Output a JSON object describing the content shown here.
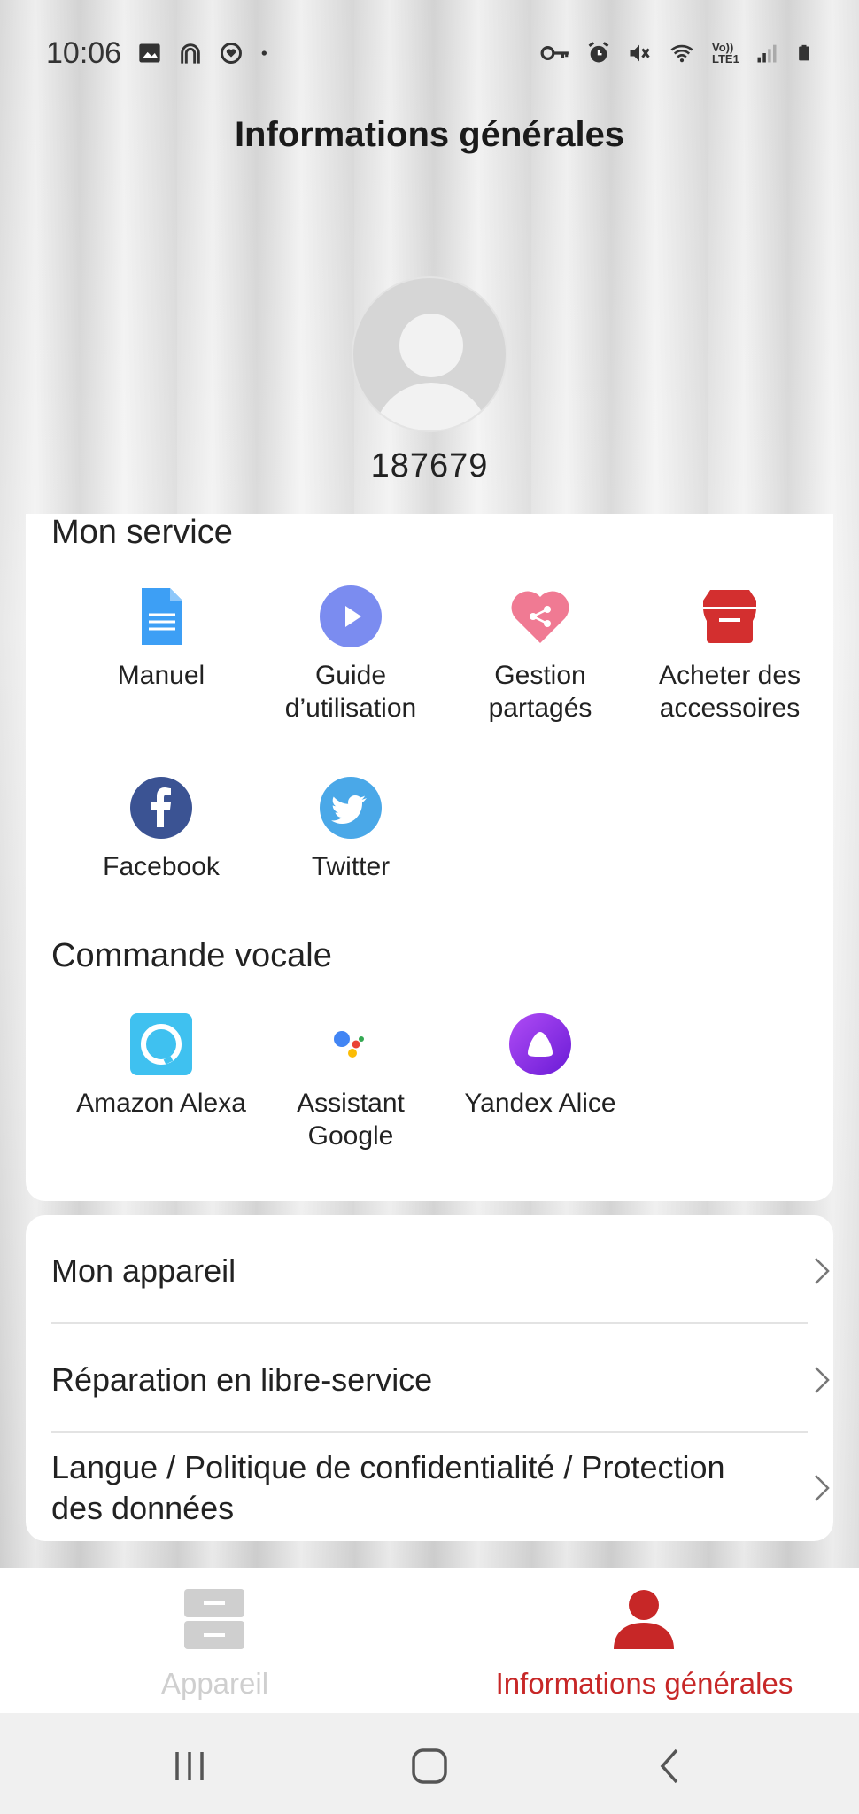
{
  "status_bar": {
    "time": "10:06",
    "left_icons": [
      "image-icon",
      "arch-icon",
      "heart-circle-icon",
      "dot-icon"
    ],
    "right_icons": [
      "key-icon",
      "alarm-icon",
      "mute-icon",
      "wifi-icon",
      "volte-icon",
      "signal-icon",
      "battery-icon"
    ],
    "volte_label": "Vo)) LTE1"
  },
  "header": {
    "title": "Informations générales"
  },
  "profile": {
    "user_id": "187679"
  },
  "mon_service": {
    "title": "Mon service",
    "items": [
      {
        "label": "Manuel",
        "icon": "document-icon",
        "color": "#3d9ff5"
      },
      {
        "label": "Guide d’utilisation",
        "icon": "play-icon",
        "color": "#7b8cf0"
      },
      {
        "label": "Gestion partagés",
        "icon": "share-heart-icon",
        "color": "#f07a93"
      },
      {
        "label": "Acheter des accessoires",
        "icon": "store-icon",
        "color": "#d32f2f"
      },
      {
        "label": "Facebook",
        "icon": "facebook-icon",
        "color": "#3b5393"
      },
      {
        "label": "Twitter",
        "icon": "twitter-icon",
        "color": "#4aa8e8"
      }
    ]
  },
  "commande_vocale": {
    "title": "Commande vocale",
    "items": [
      {
        "label": "Amazon Alexa",
        "icon": "alexa-icon",
        "color": "#3fc1f0"
      },
      {
        "label": "Assistant Google",
        "icon": "google-assistant-icon",
        "color": "#4285f4"
      },
      {
        "label": "Yandex Alice",
        "icon": "alice-icon",
        "color": "#8a2be2"
      }
    ]
  },
  "settings_list": [
    {
      "label": "Mon appareil"
    },
    {
      "label": "Réparation en libre-service"
    },
    {
      "label": "Langue / Politique de confidentialité / Protection des données"
    }
  ],
  "bottom_nav": {
    "device": {
      "label": "Appareil",
      "active": false
    },
    "info": {
      "label": "Informations générales",
      "active": true
    },
    "active_color": "#c72727",
    "inactive_color": "#cfcfcf"
  },
  "system_nav": [
    "recents-icon",
    "home-icon",
    "back-icon"
  ]
}
